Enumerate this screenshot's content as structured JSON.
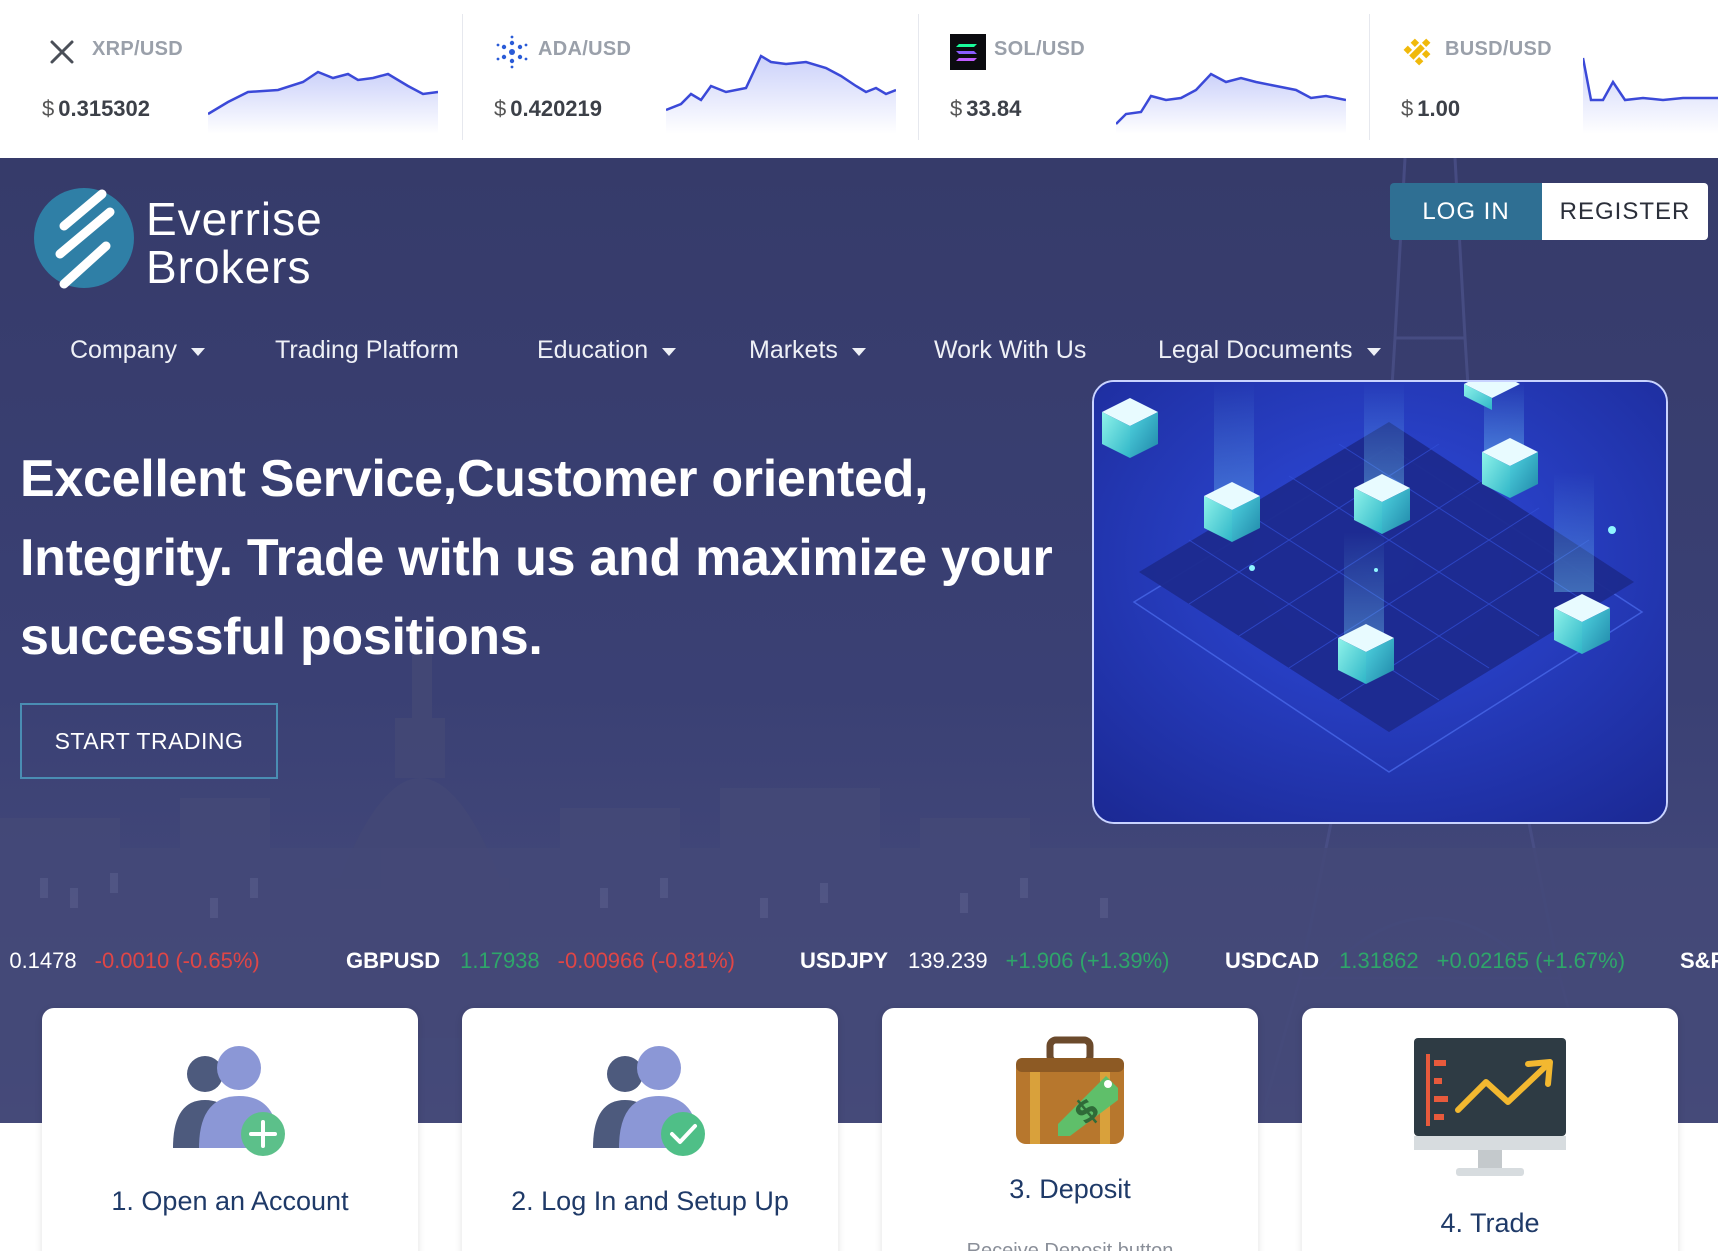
{
  "crypto_ticker": [
    {
      "pair": "XRP/USD",
      "currency": "$",
      "price": "0.315302",
      "icon": "xrp-icon"
    },
    {
      "pair": "ADA/USD",
      "currency": "$",
      "price": "0.420219",
      "icon": "ada-icon"
    },
    {
      "pair": "SOL/USD",
      "currency": "$",
      "price": "33.84",
      "icon": "sol-icon"
    },
    {
      "pair": "BUSD/USD",
      "currency": "$",
      "price": "1.00",
      "icon": "busd-icon"
    }
  ],
  "header": {
    "logo_line1": "Everrise",
    "logo_line2": "Brokers",
    "login_label": "LOG IN",
    "register_label": "REGISTER"
  },
  "nav": {
    "items": [
      {
        "label": "Company",
        "dropdown": true
      },
      {
        "label": "Trading Platform",
        "dropdown": false
      },
      {
        "label": "Education",
        "dropdown": true
      },
      {
        "label": "Markets",
        "dropdown": true
      },
      {
        "label": "Work With Us",
        "dropdown": false
      },
      {
        "label": "Legal Documents",
        "dropdown": true
      }
    ]
  },
  "hero": {
    "headline": "Excellent Service,Customer oriented, Integrity. Trade with us and maximize your successful positions.",
    "cta_label": "START TRADING"
  },
  "fx_ticker": [
    {
      "symbol": "",
      "price": "0.1478",
      "change": "-0.0010 (-0.65%)",
      "direction": "neg"
    },
    {
      "symbol": "GBPUSD",
      "price": "1.17938",
      "change": "-0.00966 (-0.81%)",
      "direction": "neg"
    },
    {
      "symbol": "USDJPY",
      "price": "139.239",
      "change": "+1.906 (+1.39%)",
      "direction": "pos"
    },
    {
      "symbol": "USDCAD",
      "price": "1.31862",
      "change": "+0.02165 (+1.67%)",
      "direction": "pos"
    },
    {
      "symbol": "S&P",
      "price": "",
      "change": "",
      "direction": "pos"
    }
  ],
  "steps": [
    {
      "title": "1. Open an Account",
      "icon": "add-user-icon"
    },
    {
      "title": "2. Log In and Setup Up",
      "icon": "verified-user-icon"
    },
    {
      "title": "3. Deposit",
      "icon": "money-suitcase-icon",
      "subtitle": "Receive Deposit button"
    },
    {
      "title": "4. Trade",
      "icon": "trading-chart-monitor-icon"
    }
  ],
  "colors": {
    "hero_bg": "#363b6a",
    "login_bg": "#2f6f93",
    "card_title": "#1f3a68",
    "negative": "#e04646",
    "positive": "#2ea66a"
  }
}
